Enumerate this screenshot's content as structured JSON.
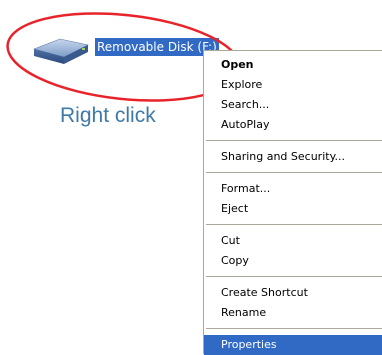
{
  "desktop": {
    "drive_label": "Removable Disk (F:)",
    "annotation": "Right click",
    "icon": "removable-disk-icon",
    "highlight_color": "#e8242a",
    "selection_color": "#316ac5"
  },
  "context_menu": {
    "group1": {
      "open": "Open",
      "explore": "Explore",
      "search": "Search...",
      "autoplay": "AutoPlay"
    },
    "group2": {
      "sharing": "Sharing and Security..."
    },
    "group3": {
      "format": "Format...",
      "eject": "Eject"
    },
    "group4": {
      "cut": "Cut",
      "copy": "Copy"
    },
    "group5": {
      "create_shortcut": "Create Shortcut",
      "rename": "Rename"
    },
    "group6": {
      "properties": "Properties"
    },
    "selected_item": "Properties"
  }
}
